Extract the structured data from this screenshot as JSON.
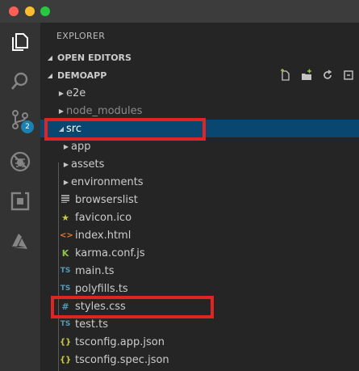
{
  "sidebar": {
    "title": "EXPLORER",
    "open_editors": "OPEN EDITORS",
    "project": "DEMOAPP"
  },
  "activity": {
    "scm_badge": "2",
    "icons": [
      "files-icon",
      "search-icon",
      "source-control-icon",
      "debug-icon",
      "extensions-icon",
      "azure-icon"
    ]
  },
  "tree": {
    "e2e": "e2e",
    "node_modules": "node_modules",
    "src": "src",
    "app": "app",
    "assets": "assets",
    "environments": "environments",
    "browserslist": "browserslist",
    "favicon": "favicon.ico",
    "index": "index.html",
    "karma": "karma.conf.js",
    "main": "main.ts",
    "polyfills": "polyfills.ts",
    "styles": "styles.css",
    "test": "test.ts",
    "tsconfig_app": "tsconfig.app.json",
    "tsconfig_spec": "tsconfig.spec.json"
  },
  "file_icons": {
    "ts": "TS",
    "css": "#",
    "json": "{}",
    "html": "<>",
    "favicon": "★",
    "karma": "K"
  },
  "colors": {
    "highlight": "#e02424",
    "selection": "#094771",
    "ts": "#519aba",
    "json": "#cbcb41",
    "html": "#e37933",
    "karma": "#8dc149",
    "badge": "#1b80b2"
  }
}
